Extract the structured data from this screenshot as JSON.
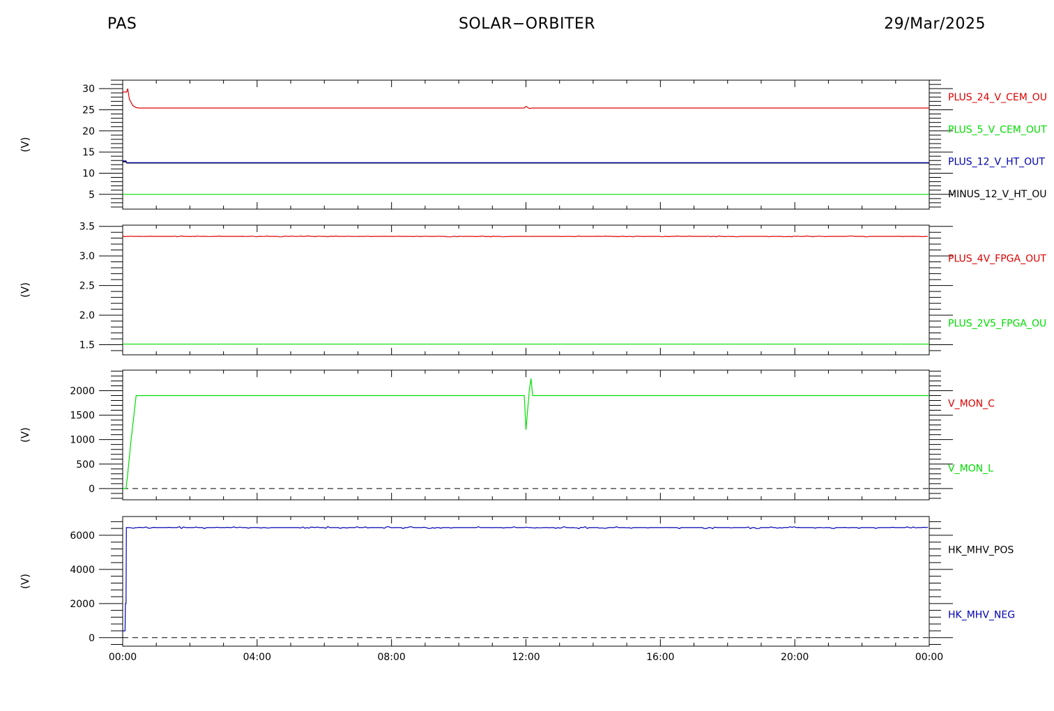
{
  "header": {
    "instrument": "PAS",
    "mission": "SOLAR−ORBITER",
    "date": "29/Mar/2025"
  },
  "x_ticks": [
    "00:00",
    "04:00",
    "08:00",
    "12:00",
    "16:00",
    "20:00",
    "00:00"
  ],
  "colors": {
    "red": "#e00000",
    "green": "#00dd00",
    "blue": "#0000b0",
    "black": "#000000"
  },
  "chart_data": [
    {
      "type": "line",
      "ylabel": "(V)",
      "ylim": [
        1.5,
        32
      ],
      "yticks": [
        5,
        10,
        15,
        20,
        25,
        30
      ],
      "xlim_hours": [
        0,
        24
      ],
      "labels": [
        {
          "text": "PLUS_24_V_CEM_OU",
          "color": "red"
        },
        {
          "text": "PLUS_5_V_CEM_OUT",
          "color": "green"
        },
        {
          "text": "PLUS_12_V_HT_OUT",
          "color": "blue"
        },
        {
          "text": "MINUS_12_V_HT_OU",
          "color": "black"
        }
      ],
      "series": [
        {
          "color": "red",
          "x": [
            0,
            0.12,
            0.15,
            0.2,
            0.3,
            0.4,
            0.5,
            11.95,
            12.0,
            12.1,
            12.2,
            24
          ],
          "y": [
            29.2,
            29.2,
            30,
            27.5,
            26,
            25.5,
            25.4,
            25.4,
            25.8,
            25.3,
            25.4,
            25.4
          ]
        },
        {
          "color": "black",
          "x": [
            0,
            0.1,
            0.12,
            24
          ],
          "y": [
            12.7,
            12.7,
            12.4,
            12.4
          ]
        },
        {
          "color": "blue",
          "x": [
            0,
            0.1,
            0.12,
            24
          ],
          "y": [
            12.9,
            12.9,
            12.5,
            12.5
          ]
        },
        {
          "color": "green",
          "x": [
            0,
            24
          ],
          "y": [
            5,
            5
          ]
        }
      ]
    },
    {
      "type": "line",
      "ylabel": "(V)",
      "ylim": [
        1.33,
        3.52
      ],
      "yticks": [
        1.5,
        2.0,
        2.5,
        3.0,
        3.5
      ],
      "ytick_labels": [
        "1.5",
        "2.0",
        "2.5",
        "3.0",
        "3.5"
      ],
      "xlim_hours": [
        0,
        24
      ],
      "labels": [
        {
          "text": "PLUS_4V_FPGA_OUT",
          "color": "red"
        },
        {
          "text": "PLUS_2V5_FPGA_OU",
          "color": "green"
        }
      ],
      "series": [
        {
          "color": "red",
          "x": [
            0,
            24
          ],
          "y": [
            3.33,
            3.33
          ],
          "noise": 0.008
        },
        {
          "color": "green",
          "x": [
            0,
            24
          ],
          "y": [
            1.51,
            1.51
          ]
        }
      ]
    },
    {
      "type": "line",
      "ylabel": "(V)",
      "ylim": [
        -230,
        2420
      ],
      "yticks": [
        0,
        500,
        1000,
        1500,
        2000
      ],
      "xlim_hours": [
        0,
        24
      ],
      "zero_line": true,
      "labels": [
        {
          "text": "V_MON_C",
          "color": "red"
        },
        {
          "text": "V_MON_L",
          "color": "green"
        }
      ],
      "series": [
        {
          "color": "green",
          "x": [
            0,
            0.1,
            0.15,
            0.25,
            0.35,
            0.4,
            11.95,
            12.0,
            12.1,
            12.15,
            12.2,
            24
          ],
          "y": [
            0,
            0,
            300,
            1000,
            1600,
            1900,
            1900,
            1200,
            2000,
            2250,
            1900,
            1900
          ]
        }
      ]
    },
    {
      "type": "line",
      "ylabel": "(V)",
      "ylim": [
        -500,
        7100
      ],
      "yticks": [
        0,
        2000,
        4000,
        6000
      ],
      "xlim_hours": [
        0,
        24
      ],
      "zero_line": true,
      "labels": [
        {
          "text": "HK_MHV_POS",
          "color": "black"
        },
        {
          "text": "HK_MHV_NEG",
          "color": "blue"
        }
      ],
      "series": [
        {
          "color": "blue",
          "x": [
            0,
            0.07,
            0.08,
            0.1,
            0.11,
            0.13,
            24
          ],
          "y": [
            400,
            400,
            2000,
            2000,
            6450,
            6450,
            6450
          ],
          "noise": 60
        }
      ]
    }
  ]
}
